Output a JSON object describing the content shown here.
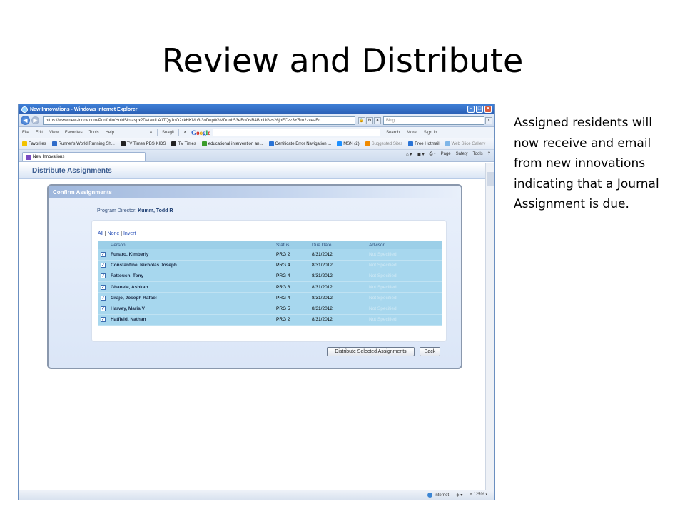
{
  "slide": {
    "title": "Review and Distribute",
    "side_text": "Assigned residents will now receive and email from new innovations indicating that a Journal Assignment is due."
  },
  "browser": {
    "window_title": "New Innovations - Windows Internet Explorer",
    "url": "https://www.new-innov.com/Portfolio/HoldSio.aspx?Data=ILA17Qy1oO2xkHKMu3t3oDup0GMDuob53eBoOsR4BmUGvs26jbECzz3YRm2zveaEc",
    "search_placeholder": "Bing",
    "menu": [
      "File",
      "Edit",
      "View",
      "Favorites",
      "Tools",
      "Help"
    ],
    "snagit": "Snagit",
    "google_tools": [
      "Search",
      "More",
      "Sign In"
    ],
    "favorites_label": "Favorites",
    "favorites": [
      "Runner's World Running Sh...",
      "TV Times PBS KIDS",
      "TV Times",
      "educational intervention an...",
      "Certificate Error Navigation ...",
      "MSN (2)",
      "Suggested Sites",
      "Free Hotmail",
      "Web Slice Gallery"
    ],
    "tab_label": "New Innovations",
    "command_bar": [
      "Page",
      "Safety",
      "Tools"
    ],
    "status_zone": "Internet",
    "zoom": "125%"
  },
  "page": {
    "header": "Distribute Assignments",
    "panel_title": "Confirm Assignments",
    "director_label": "Program Director:",
    "director_name": "Kumm, Todd R",
    "select_links": {
      "all": "All",
      "none": "None",
      "invert": "Invert",
      "sep": "|"
    },
    "columns": [
      "Person",
      "Status",
      "Due Date",
      "Advisor"
    ],
    "rows": [
      {
        "person": "Funaro, Kimberly",
        "status": "PRG 2",
        "due": "8/31/2012",
        "advisor": "Not Specified"
      },
      {
        "person": "Constantine, Nicholas Joseph",
        "status": "PRG 4",
        "due": "8/31/2012",
        "advisor": "Not Specified"
      },
      {
        "person": "Fattouch, Tony",
        "status": "PRG 4",
        "due": "8/31/2012",
        "advisor": "Not Specified"
      },
      {
        "person": "Ghaneie, Ashkan",
        "status": "PRG 3",
        "due": "8/31/2012",
        "advisor": "Not Specified"
      },
      {
        "person": "Grajo, Joseph Rafael",
        "status": "PRG 4",
        "due": "8/31/2012",
        "advisor": "Not Specified"
      },
      {
        "person": "Harvey, Maria V",
        "status": "PRG 5",
        "due": "8/31/2012",
        "advisor": "Not Specified"
      },
      {
        "person": "Hatfield, Nathan",
        "status": "PRG 2",
        "due": "8/31/2012",
        "advisor": "Not Specified"
      }
    ],
    "distribute_button": "Distribute Selected Assignments",
    "back_button": "Back"
  },
  "colors": {
    "row_bg": "#a7d7ee",
    "header_text": "#3e5f92",
    "link": "#2a52b8"
  }
}
